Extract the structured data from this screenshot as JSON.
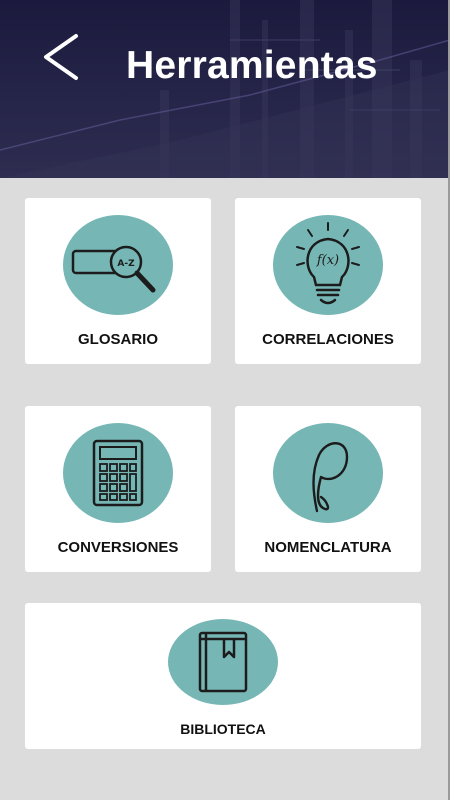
{
  "header": {
    "back_icon": "chevron-left-icon",
    "title": "Herramientas"
  },
  "tools": [
    {
      "label": "GLOSARIO",
      "icon": "glossary-search-icon"
    },
    {
      "label": "CORRELACIONES",
      "icon": "lightbulb-function-icon"
    },
    {
      "label": "CONVERSIONES",
      "icon": "calculator-icon"
    },
    {
      "label": "NOMENCLATURA",
      "icon": "rho-symbol-icon"
    },
    {
      "label": "BIBLIOTECA",
      "icon": "book-icon"
    }
  ],
  "colors": {
    "header_bg": "#1b1a3d",
    "icon_circle": "#76b7b6",
    "page_bg": "#dcdcdc",
    "card_bg": "#ffffff"
  }
}
